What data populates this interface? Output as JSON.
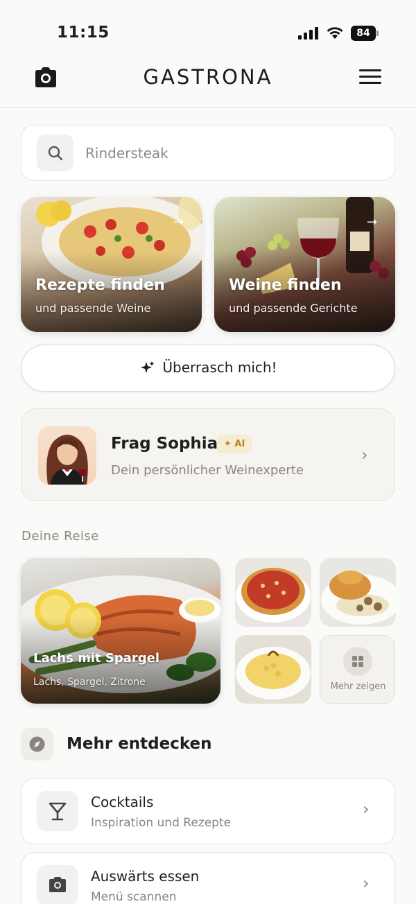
{
  "status_bar": {
    "time": "11:15",
    "battery": "84"
  },
  "header": {
    "brand": "GASTRONA",
    "camera_icon": "camera-icon",
    "menu_icon": "hamburger-menu-icon"
  },
  "search": {
    "placeholder": "Rindersteak",
    "icon": "search-icon"
  },
  "hero_cards": [
    {
      "title": "Rezepte finden",
      "subtitle": "und passende Weine",
      "arrow": "→"
    },
    {
      "title": "Weine finden",
      "subtitle": "und passende Gerichte",
      "arrow": "→"
    }
  ],
  "surprise": {
    "label": "Überrasch mich!",
    "icon": "sparkle-icon"
  },
  "sophia": {
    "name": "Frag Sophia",
    "badge": "AI",
    "subtitle": "Dein persönlicher Weinexperte"
  },
  "journey": {
    "label": "Deine Reise",
    "featured": {
      "title": "Lachs mit Spargel",
      "subtitle": "Lachs, Spargel, Zitrone"
    },
    "more_label": "Mehr zeigen"
  },
  "discover": {
    "title": "Mehr entdecken",
    "icon": "compass-icon",
    "items": [
      {
        "title": "Cocktails",
        "subtitle": "Inspiration und Rezepte",
        "icon": "cocktail-icon"
      },
      {
        "title": "Auswärts essen",
        "subtitle": "Menü scannen",
        "icon": "camera-icon"
      }
    ]
  },
  "colors": {
    "background": "#fafaf9",
    "accent_badge": "#b88a1f",
    "text_primary": "#1f1f1f",
    "text_secondary": "#8a857f"
  }
}
